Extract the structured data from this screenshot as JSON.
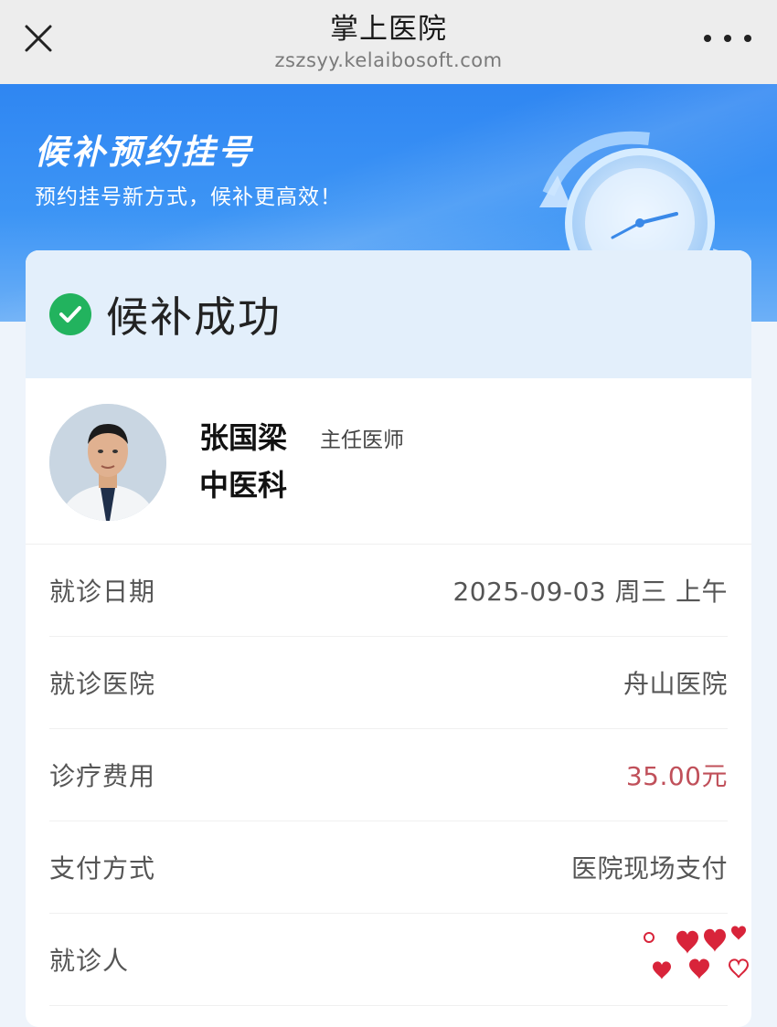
{
  "topbar": {
    "title": "掌上医院",
    "url": "zszsyy.kelaibosoft.com"
  },
  "banner": {
    "title": "候补预约挂号",
    "subtitle": "预约挂号新方式，候补更高效！"
  },
  "status": {
    "text": "候补成功",
    "color": "#22b35e"
  },
  "doctor": {
    "name": "张国梁",
    "title": "主任医师",
    "department": "中医科"
  },
  "details": [
    {
      "label": "就诊日期",
      "value": "2025-09-03 周三 上午"
    },
    {
      "label": "就诊医院",
      "value": "舟山医院"
    },
    {
      "label": "诊疗费用",
      "value": "35.00元"
    },
    {
      "label": "支付方式",
      "value": "医院现场支付"
    },
    {
      "label": "就诊人",
      "value": ""
    }
  ],
  "colors": {
    "banner": "#2f86f2",
    "fee": "#c0505a",
    "status_bg": "#e3effb"
  },
  "icons": {
    "close": "close-icon",
    "more": "more-icon",
    "status": "check-circle-icon"
  }
}
